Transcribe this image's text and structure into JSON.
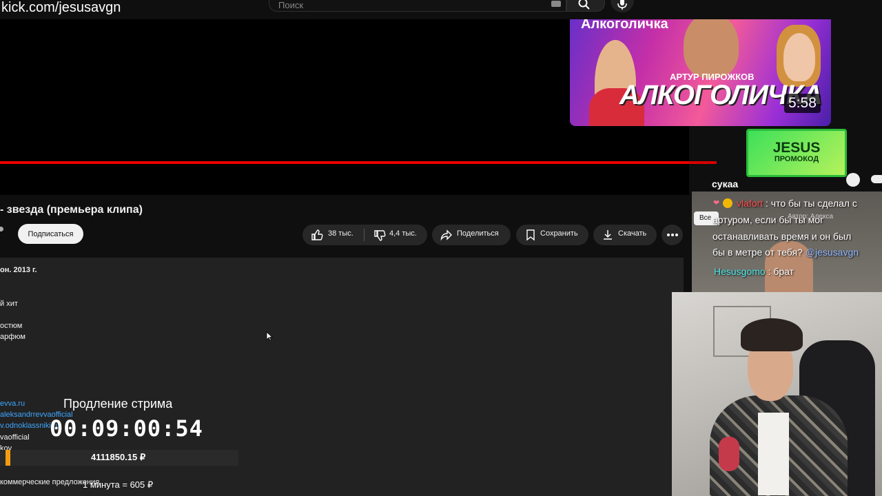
{
  "stream": {
    "url": "kick.com/jesusavgn"
  },
  "search": {
    "placeholder": "Поиск"
  },
  "thumbnail": {
    "title_top": "Алкоголичка",
    "artist": "АРТУР ПИРОЖКОВ",
    "title": "АЛКОГОЛИЧКА",
    "duration": "5:58"
  },
  "promo": {
    "name": "JESUS",
    "subtitle": "ПРОМОКОД"
  },
  "video": {
    "title": "- звезда (премьера клипа)",
    "subscribe_label": "Подписаться",
    "likes": "38 тыс.",
    "dislikes": "4,4 тыс.",
    "share_label": "Поделиться",
    "save_label": "Сохранить",
    "download_label": "Скачать"
  },
  "description": {
    "date": "он. 2013 г.",
    "lines": [
      "й хит",
      "остюм",
      "арфюм"
    ],
    "links": [
      "evva.ru",
      "aleksandrrevvaofficial",
      "v.odnoklassniki.ru"
    ],
    "line_official": "vaofficial",
    "line_kov": "kov",
    "line_a": "а",
    "footer": "коммерческие предложения"
  },
  "overlay": {
    "timer_label": "Продление стрима",
    "timer": "00:09:00:54",
    "money": "4111850.15 ₽",
    "rate": "1 минута = 605 ₽",
    "money_progress": 0.02
  },
  "chat": {
    "header": "сукаа",
    "chip_all": "Все",
    "chip_author": "Автор: Алекса",
    "messages": [
      {
        "user": "vlafort",
        "sep": " : ",
        "text": "что бы ты сделал с",
        "color": "#ff4d4d"
      },
      {
        "text": "артуром, если бы ты мог"
      },
      {
        "text": "останавливать время и он был"
      },
      {
        "text": "бы в метре от тебя?",
        "mention": "@jesusavgn"
      },
      {
        "user": "Hesusgomo",
        "sep": " : ",
        "text": "брат",
        "color": "#4de8e8"
      }
    ]
  },
  "colors": {
    "accent": "#ff0000",
    "link": "#3ea6ff",
    "promo": "#3de05a"
  }
}
